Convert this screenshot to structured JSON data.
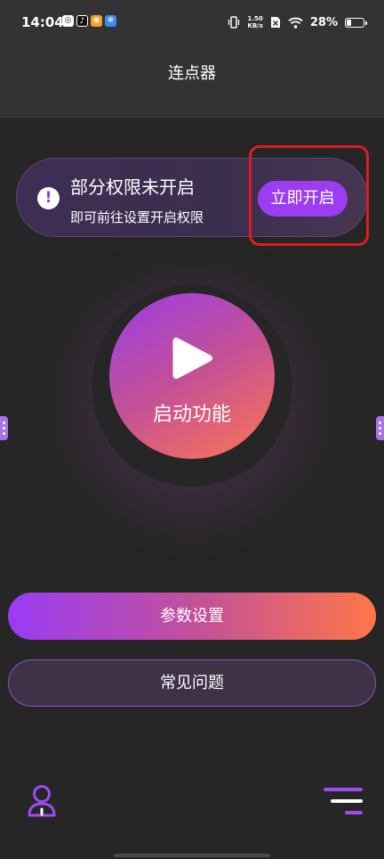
{
  "status_bar": {
    "time": "14:04",
    "net_speed_value": "1.50",
    "net_speed_unit": "KB/s",
    "battery": "28%",
    "battery_level": 0.28
  },
  "header": {
    "title": "连点器"
  },
  "permission_card": {
    "title": "部分权限未开启",
    "subtitle": "即可前往设置开启权限",
    "button_label": "立即开启"
  },
  "start": {
    "label": "启动功能"
  },
  "buttons": {
    "params": "参数设置",
    "faq": "常见问题"
  },
  "icons": {
    "alert": "exclamation-icon",
    "play": "play-icon",
    "user": "user-icon",
    "menu": "menu-icon"
  },
  "colors": {
    "background": "#262626",
    "header": "#333333",
    "accent_purple": "#9b3df0",
    "accent_orange": "#ff7550",
    "highlight_red": "#e01b24"
  }
}
